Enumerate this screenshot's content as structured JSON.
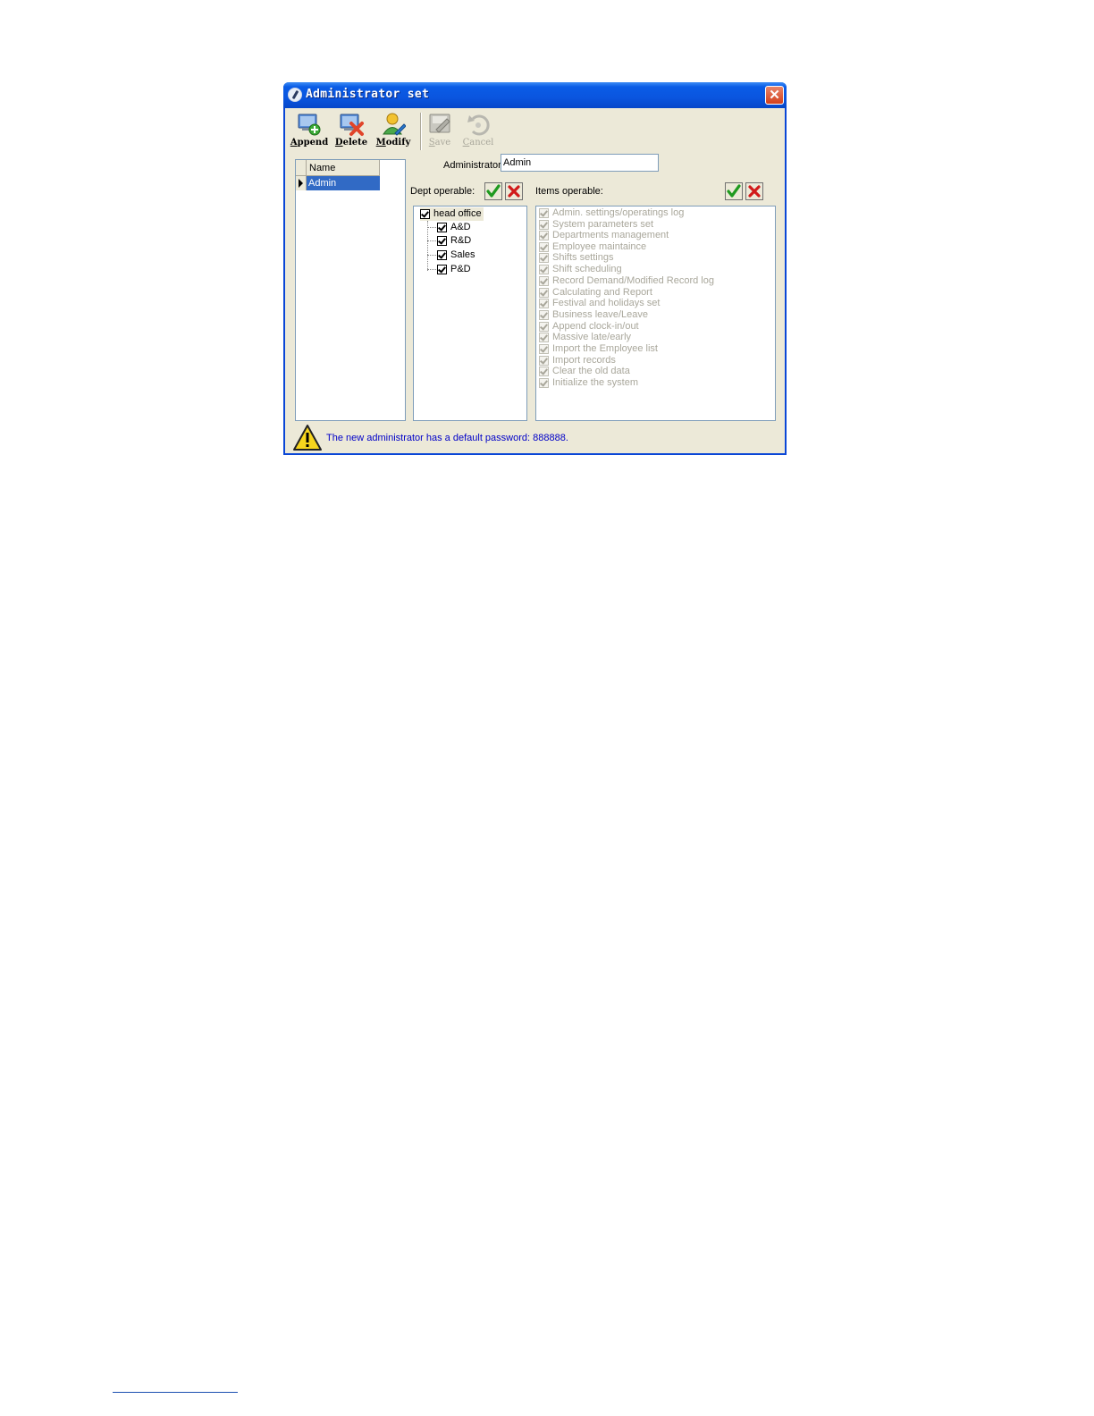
{
  "window": {
    "title": "Administrator set"
  },
  "toolbar": {
    "append": {
      "hotkey": "A",
      "rest": "ppend",
      "icon": "append-user-icon",
      "enabled": true
    },
    "delete": {
      "hotkey": "D",
      "rest": "elete",
      "icon": "delete-user-icon",
      "enabled": true
    },
    "modify": {
      "hotkey": "M",
      "rest": "odify",
      "icon": "modify-user-icon",
      "enabled": true
    },
    "save": {
      "hotkey": "S",
      "rest": "ave",
      "icon": "save-icon",
      "enabled": false
    },
    "cancel": {
      "hotkey": "C",
      "rest": "ancel",
      "icon": "cancel-icon",
      "enabled": false
    }
  },
  "admin_grid": {
    "column_header": "Name",
    "rows": [
      "Admin"
    ]
  },
  "admin_field": {
    "label": "Administrator:",
    "value": "Admin"
  },
  "dept": {
    "label": "Dept operable:",
    "tree": {
      "root": "head office",
      "children": [
        "A&D",
        "R&D",
        "Sales",
        "P&D"
      ]
    }
  },
  "items": {
    "label": "Items operable:",
    "list": [
      "Admin. settings/operatings log",
      "System parameters set",
      "Departments management",
      "Employee maintaince",
      "Shifts settings",
      "Shift scheduling",
      "Record Demand/Modified Record log",
      "Calculating and Report",
      "Festival and holidays set",
      "Business leave/Leave",
      "Append clock-in/out",
      "Massive late/early",
      "Import the Employee list",
      "Import records",
      "Clear the old data",
      "Initialize the system"
    ]
  },
  "status": {
    "message": "The new administrator has a default password: 888888.",
    "icon": "warning-icon"
  },
  "colors": {
    "titlebar": "#0a55df",
    "selection": "#316ac5",
    "status_text": "#0000c8",
    "disabled_text": "#a9a79b"
  }
}
